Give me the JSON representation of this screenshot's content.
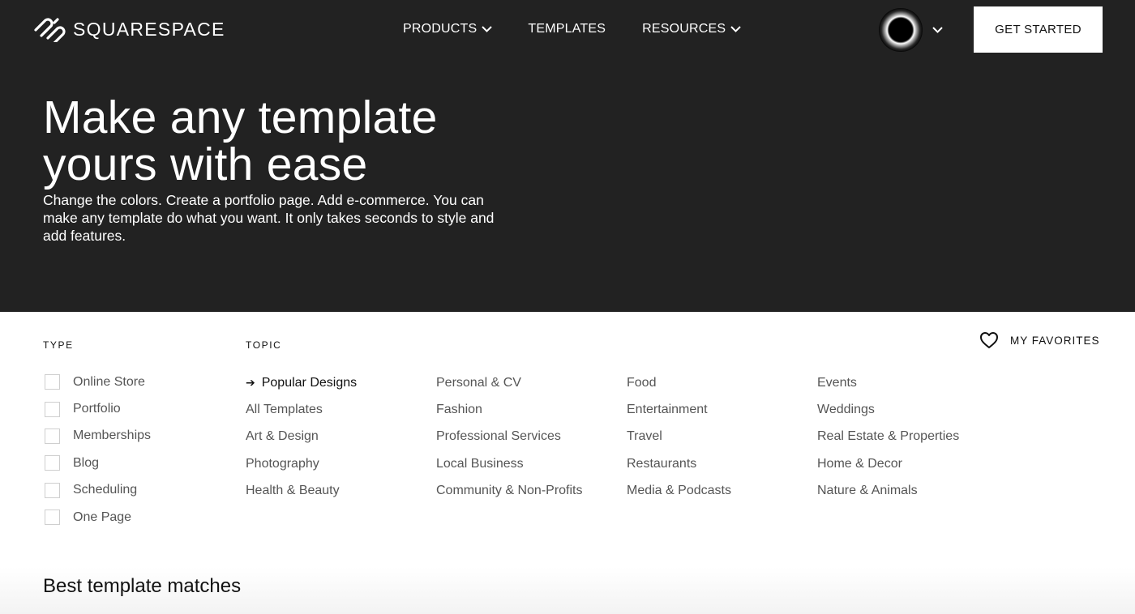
{
  "brand": {
    "name": "SQUARESPACE",
    "logo_icon": "squarespace-logo-icon"
  },
  "nav": {
    "items": [
      {
        "label": "PRODUCTS",
        "has_dropdown": true
      },
      {
        "label": "TEMPLATES",
        "has_dropdown": false
      },
      {
        "label": "RESOURCES",
        "has_dropdown": true
      }
    ],
    "cta_label": "GET STARTED"
  },
  "hero": {
    "title": "Make any template yours with ease",
    "subtitle": "Change the colors. Create a portfolio page. Add e-commerce. You can make any template do what you want. It only takes seconds to style and add features."
  },
  "filters": {
    "type_label": "TYPE",
    "topic_label": "TOPIC",
    "favorites_label": "MY FAVORITES",
    "types": [
      "Online Store",
      "Portfolio",
      "Memberships",
      "Blog",
      "Scheduling",
      "One Page"
    ],
    "topics": {
      "col1": [
        "Popular Designs",
        "All Templates",
        "Art & Design",
        "Photography",
        "Health & Beauty"
      ],
      "col2": [
        "Personal & CV",
        "Fashion",
        "Professional Services",
        "Local Business",
        "Community & Non-Profits"
      ],
      "col3": [
        "Food",
        "Entertainment",
        "Travel",
        "Restaurants",
        "Media & Podcasts"
      ],
      "col4": [
        "Events",
        "Weddings",
        "Real Estate & Properties",
        "Home & Decor",
        "Nature & Animals"
      ]
    },
    "active_topic": "Popular Designs"
  },
  "results": {
    "title": "Best template matches"
  },
  "colors": {
    "hero_bg": "#222222",
    "text_muted": "#555555",
    "text_dark": "#111111"
  }
}
